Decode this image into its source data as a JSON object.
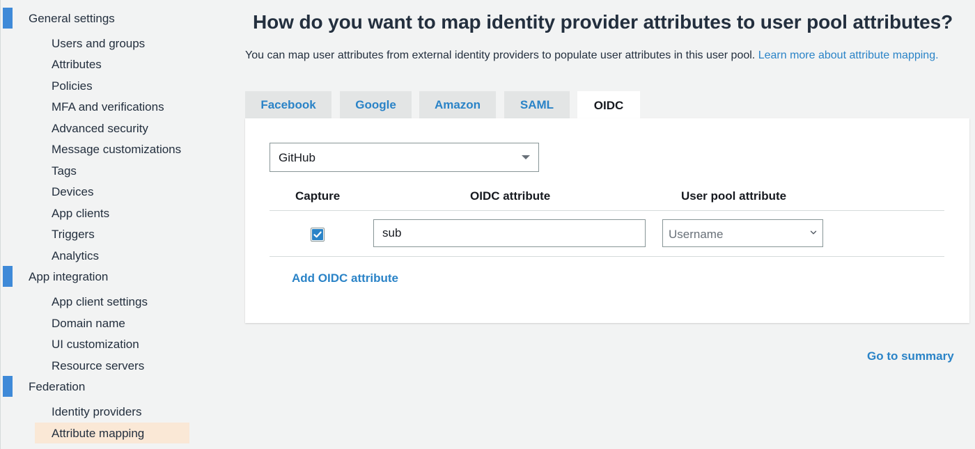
{
  "sidebar": {
    "sections": [
      {
        "label": "General settings",
        "items": [
          "Users and groups",
          "Attributes",
          "Policies",
          "MFA and verifications",
          "Advanced security",
          "Message customizations",
          "Tags",
          "Devices",
          "App clients",
          "Triggers",
          "Analytics"
        ]
      },
      {
        "label": "App integration",
        "items": [
          "App client settings",
          "Domain name",
          "UI customization",
          "Resource servers"
        ]
      },
      {
        "label": "Federation",
        "items": [
          "Identity providers",
          "Attribute mapping"
        ]
      }
    ],
    "active_item": "Attribute mapping"
  },
  "main": {
    "title": "How do you want to map identity provider attributes to user pool attributes?",
    "subtitle": "You can map user attributes from external identity providers to populate user attributes in this user pool.",
    "subtitle_link": "Learn more about attribute mapping.",
    "tabs": [
      {
        "label": "Facebook",
        "active": false
      },
      {
        "label": "Google",
        "active": false
      },
      {
        "label": "Amazon",
        "active": false
      },
      {
        "label": "SAML",
        "active": false
      },
      {
        "label": "OIDC",
        "active": true
      }
    ],
    "provider_select": {
      "value": "GitHub"
    },
    "table": {
      "headers": {
        "capture": "Capture",
        "oidc_attribute": "OIDC attribute",
        "user_pool_attribute": "User pool attribute"
      },
      "rows": [
        {
          "capture": true,
          "oidc_attribute": "sub",
          "user_pool_attribute": "Username"
        }
      ]
    },
    "add_attribute_label": "Add OIDC attribute",
    "go_to_summary_label": "Go to summary"
  },
  "colors": {
    "accent": "#2a83c7",
    "section_marker": "#3f8ad8",
    "active_item_bg": "#fae8d6",
    "page_bg": "#f2f3f3"
  }
}
